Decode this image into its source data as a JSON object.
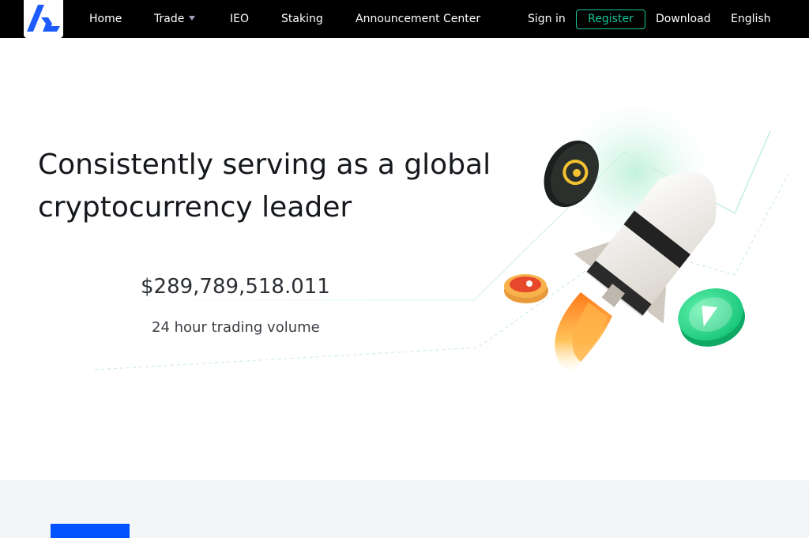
{
  "nav": {
    "logo": "logo-mark",
    "items": [
      {
        "label": "Home"
      },
      {
        "label": "Trade",
        "has_dropdown": true
      },
      {
        "label": "IEO"
      },
      {
        "label": "Staking"
      },
      {
        "label": "Announcement Center"
      }
    ],
    "sign_in": "Sign in",
    "register": "Register",
    "download": "Download",
    "language": "English"
  },
  "hero": {
    "title": "Consistently serving as a global cryptocurrency leader",
    "volume_value": "$289,789,518.011",
    "volume_label": "24 hour trading volume"
  },
  "colors": {
    "nav_background": "#000000",
    "accent": "#19c598",
    "brand_blue": "#0052ff"
  }
}
